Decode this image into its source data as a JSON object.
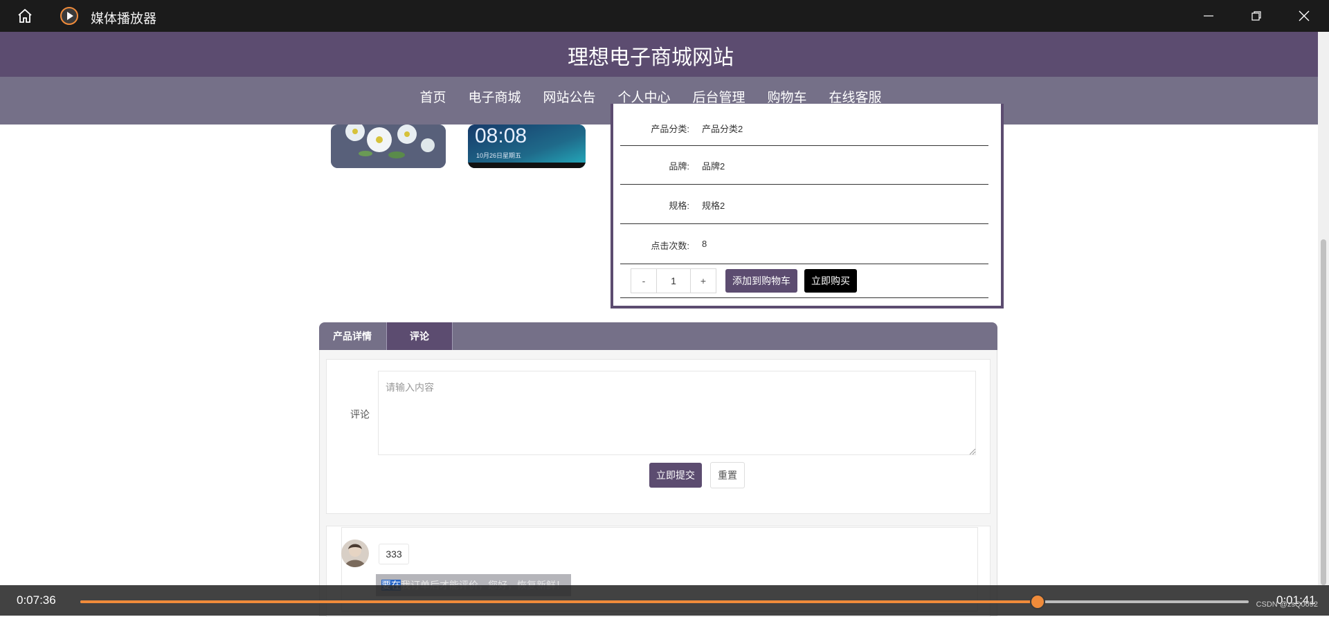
{
  "window": {
    "title": "媒体播放器",
    "icons": {
      "home": "home-icon",
      "app": "play-icon",
      "minimize": "minimize-icon",
      "restore": "restore-icon",
      "close": "close-icon"
    }
  },
  "site": {
    "title": "理想电子商城网站",
    "nav": [
      "首页",
      "电子商城",
      "网站公告",
      "个人中心",
      "后台管理",
      "购物车",
      "在线客服"
    ],
    "active_nav": "个人中心"
  },
  "product": {
    "rows": [
      {
        "label": "产品分类:",
        "value": "产品分类2"
      },
      {
        "label": "品牌:",
        "value": "品牌2"
      },
      {
        "label": "规格:",
        "value": "规格2"
      },
      {
        "label": "点击次数:",
        "value": "8"
      }
    ],
    "qty": {
      "minus": "-",
      "value": "1",
      "plus": "+"
    },
    "add_to_cart": "添加到购物车",
    "buy_now": "立即购买",
    "phone_time": "08:08",
    "phone_date": "10月26日星期五"
  },
  "tabs": {
    "details": "产品详情",
    "comments": "评论"
  },
  "comment_form": {
    "label": "评论",
    "placeholder": "请输入内容",
    "submit": "立即提交",
    "reset": "重置"
  },
  "comments": [
    {
      "text": "333"
    }
  ],
  "subtitle": {
    "highlight": "要在",
    "rest": "我订单后才能评价，您好，恢复新鲜！"
  },
  "player": {
    "elapsed": "0:07:36",
    "remaining": "0:01:41",
    "progress": 0.818,
    "watermark": "CSDN @zsQ0092"
  },
  "colors": {
    "header": "#5c4c70",
    "nav": "#757088",
    "accent": "#f08b3a"
  }
}
